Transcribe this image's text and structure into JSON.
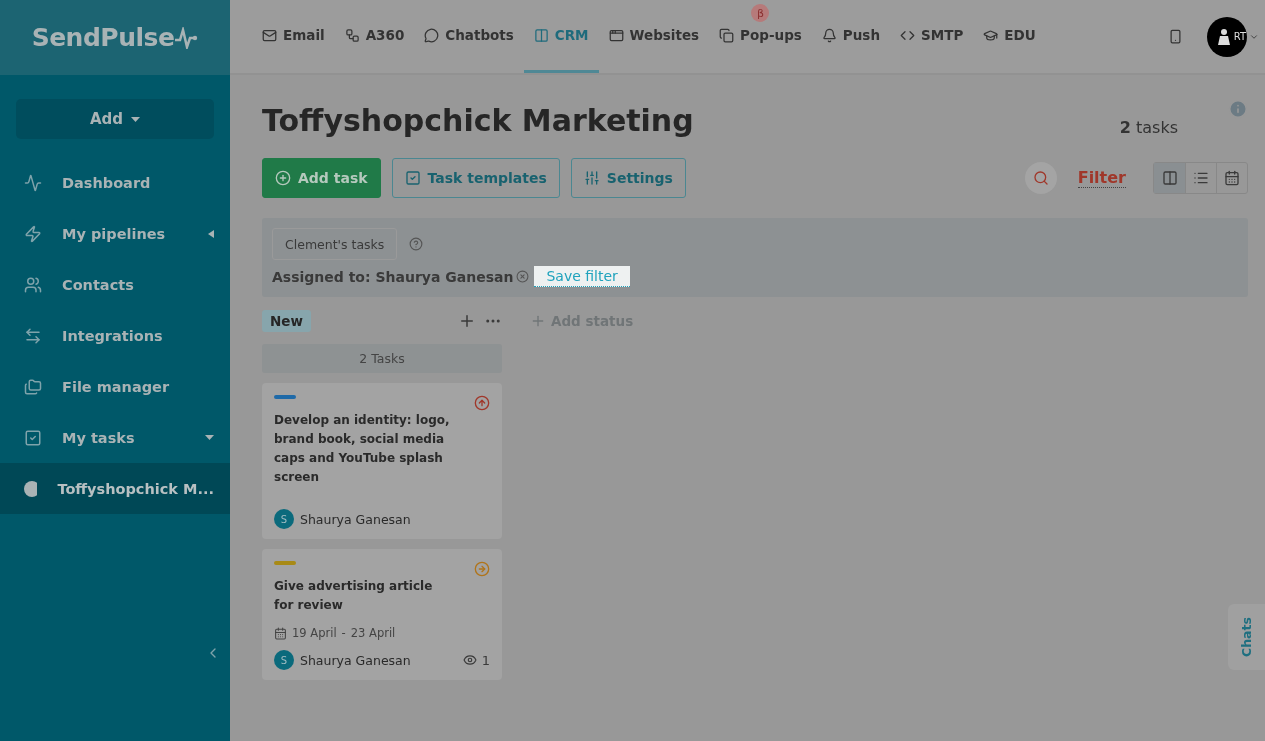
{
  "logo": {
    "text": "SendPulse"
  },
  "sidebar": {
    "add_button": "Add",
    "items": [
      {
        "label": "Dashboard",
        "selected": false
      },
      {
        "label": "My pipelines",
        "selected": false
      },
      {
        "label": "Contacts",
        "selected": false
      },
      {
        "label": "Integrations",
        "selected": false
      },
      {
        "label": "File manager",
        "selected": false
      },
      {
        "label": "My tasks",
        "selected": false
      },
      {
        "label": "Toffyshopchick M...",
        "selected": true
      }
    ]
  },
  "nav": [
    {
      "label": "Email",
      "selected": false
    },
    {
      "label": "A360",
      "selected": false
    },
    {
      "label": "Chatbots",
      "selected": false
    },
    {
      "label": "CRM",
      "selected": true
    },
    {
      "label": "Websites",
      "selected": false
    },
    {
      "label": "Pop-ups",
      "selected": false,
      "badge": "β"
    },
    {
      "label": "Push",
      "selected": false
    },
    {
      "label": "SMTP",
      "selected": false
    },
    {
      "label": "EDU",
      "selected": false
    }
  ],
  "user": {
    "avatar_text": "RT"
  },
  "header": {
    "title": "Toffyshopchick Marketing",
    "count": "2",
    "count_label": "tasks"
  },
  "toolbar": {
    "buttons": [
      {
        "label": "Add task",
        "kind": "primary"
      },
      {
        "label": "Task templates",
        "kind": "outline"
      },
      {
        "label": "Settings",
        "kind": "outline"
      }
    ],
    "filter_label": "Filter",
    "views": [
      {
        "selected": true
      },
      {
        "selected": false
      },
      {
        "selected": false
      }
    ]
  },
  "filter_panel": {
    "preset": "Clement's tasks",
    "condition": "Assigned to: Shaurya Ganesan",
    "save": "Save filter"
  },
  "board": {
    "add_status": "Add status",
    "columns": [
      {
        "name": "New",
        "count": "2 Tasks",
        "cards": [
          {
            "title": "Develop an identity: logo, brand book, social media caps and YouTube splash screen",
            "color": "#1f6aa8",
            "assignee_initial": "S",
            "assignee": "Shaurya Ganesan"
          },
          {
            "title": "Give advertising article for review",
            "color": "#a88a16",
            "date_start": "19 April",
            "date_sep": "-",
            "date_end": "23 April",
            "assignee_initial": "S",
            "assignee": "Shaurya Ganesan",
            "views": "1"
          }
        ]
      }
    ]
  },
  "chats": "Chats"
}
